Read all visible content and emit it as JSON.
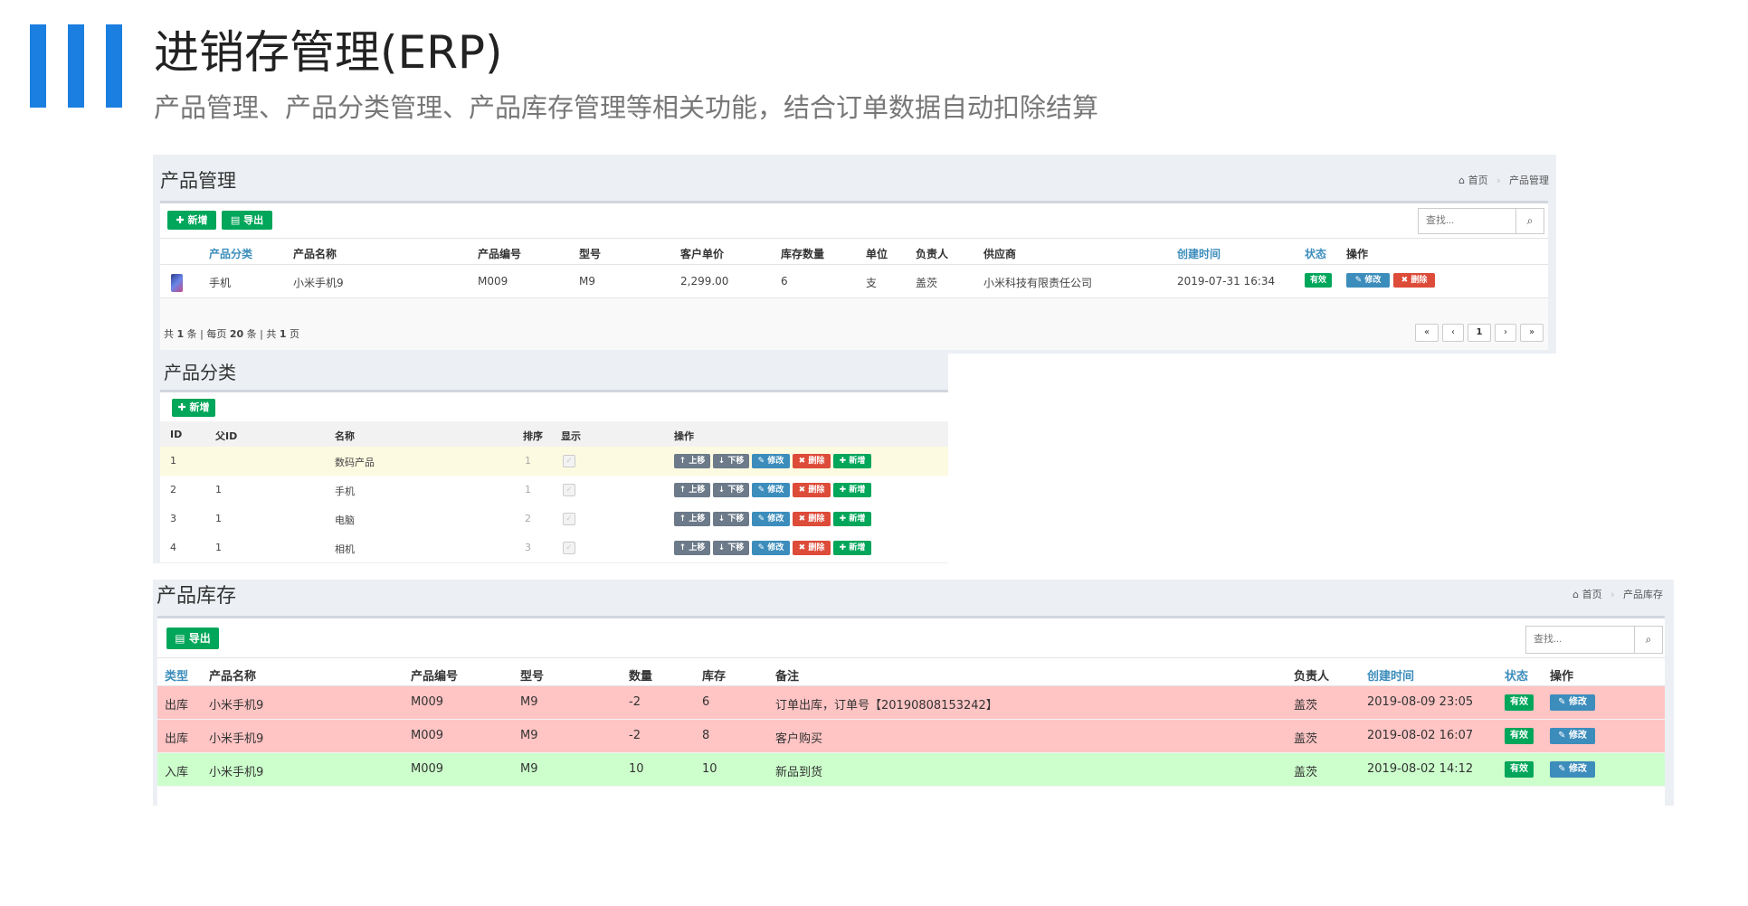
{
  "header": {
    "title": "进销存管理(ERP)",
    "subtitle": "产品管理、产品分类管理、产品库存管理等相关功能，结合订单数据自动扣除结算",
    "accent": "#1a7fe0"
  },
  "product": {
    "title": "产品管理",
    "breadcrumb": [
      "首页",
      "产品管理"
    ],
    "add_label": "新增",
    "export_label": "导出",
    "search_placeholder": "查找...",
    "columns": [
      "产品分类",
      "产品名称",
      "产品编号",
      "型号",
      "客户单价",
      "库存数量",
      "单位",
      "负责人",
      "供应商",
      "创建时间",
      "状态",
      "操作"
    ],
    "rows": [
      {
        "image": "phone-thumbnail",
        "category": "手机",
        "name": "小米手机9",
        "code": "M009",
        "model": "M9",
        "price": "2,299.00",
        "stock": "6",
        "unit": "支",
        "owner": "盖茨",
        "supplier": "小米科技有限责任公司",
        "created": "2019-07-31 16:34",
        "status": "有效",
        "edit": "修改",
        "delete": "删除"
      }
    ],
    "footer": {
      "p1": "共",
      "total": "1",
      "p2": "条 | 每页",
      "per_page": "20",
      "p3": "条 | 共",
      "pages": "1",
      "p4": "页"
    },
    "pager": [
      "«",
      "‹",
      "1",
      "›",
      "»"
    ]
  },
  "category": {
    "title": "产品分类",
    "add_label": "新增",
    "columns": [
      "ID",
      "父ID",
      "名称",
      "排序",
      "显示",
      "操作"
    ],
    "actions": {
      "up": "上移",
      "down": "下移",
      "edit": "修改",
      "delete": "删除",
      "add": "新增"
    },
    "rows": [
      {
        "id": "1",
        "pid": "",
        "name": "数码产品",
        "sort": "1"
      },
      {
        "id": "2",
        "pid": "1",
        "name": "手机",
        "sort": "1"
      },
      {
        "id": "3",
        "pid": "1",
        "name": "电脑",
        "sort": "2"
      },
      {
        "id": "4",
        "pid": "1",
        "name": "相机",
        "sort": "3"
      }
    ]
  },
  "stock": {
    "title": "产品库存",
    "breadcrumb": [
      "首页",
      "产品库存"
    ],
    "export_label": "导出",
    "search_placeholder": "查找...",
    "columns": [
      "类型",
      "产品名称",
      "产品编号",
      "型号",
      "数量",
      "库存",
      "备注",
      "负责人",
      "创建时间",
      "状态",
      "操作"
    ],
    "rows": [
      {
        "type": "出库",
        "name": "小米手机9",
        "code": "M009",
        "model": "M9",
        "qty": "-2",
        "stock": "6",
        "note": "订单出库，订单号【20190808153242】",
        "owner": "盖茨",
        "created": "2019-08-09 23:05",
        "status": "有效",
        "edit": "修改",
        "color": "#ffc4c4"
      },
      {
        "type": "出库",
        "name": "小米手机9",
        "code": "M009",
        "model": "M9",
        "qty": "-2",
        "stock": "8",
        "note": "客户购买",
        "owner": "盖茨",
        "created": "2019-08-02 16:07",
        "status": "有效",
        "edit": "修改",
        "color": "#ffc4c4"
      },
      {
        "type": "入库",
        "name": "小米手机9",
        "code": "M009",
        "model": "M9",
        "qty": "10",
        "stock": "10",
        "note": "新品到货",
        "owner": "盖茨",
        "created": "2019-08-02 14:12",
        "status": "有效",
        "edit": "修改",
        "color": "#ccffcc"
      }
    ]
  }
}
